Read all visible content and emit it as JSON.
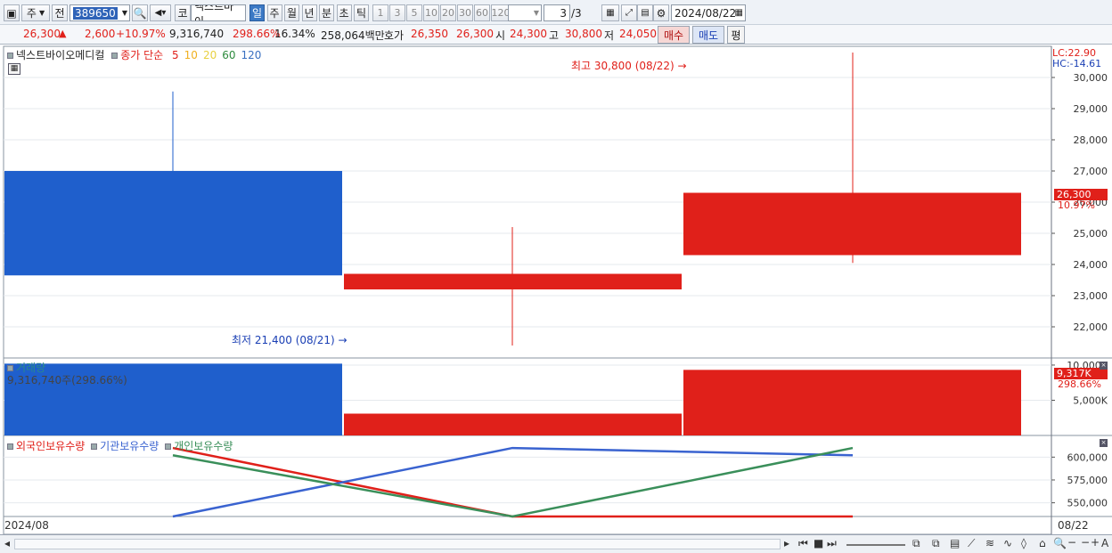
{
  "toolbar": {
    "market": "주",
    "prev": "전",
    "code": "389650",
    "kospi_tag": "코",
    "stock_name": "넥스트바이",
    "periods": [
      "일",
      "주",
      "월",
      "년",
      "분",
      "초",
      "틱"
    ],
    "active_period": "일",
    "intervals": [
      "1",
      "3",
      "5",
      "10",
      "20",
      "30",
      "60",
      "120"
    ],
    "page": "3",
    "page_total": "/3",
    "date": "2024/08/22"
  },
  "quote": {
    "price": "26,300",
    "arrow": "▲",
    "change": "2,600",
    "change_pct": "+10.97%",
    "volume": "9,316,740",
    "volume_ratio": "298.66%",
    "turnover": "16.34%",
    "amount": "258,064백만",
    "ask_label": "호가",
    "ask": "26,350",
    "bid": "26,300",
    "open_label": "시",
    "open": "24,300",
    "high_label": "고",
    "high": "30,800",
    "low_label": "저",
    "low": "24,050",
    "buy_label": "매수",
    "sell_label": "매도",
    "avg_label": "평"
  },
  "price_panel": {
    "title": "넥스트바이오메디컬",
    "indicator": "종가 단순",
    "ma_periods": [
      "5",
      "10",
      "20",
      "60",
      "120"
    ],
    "ma_colors": [
      "#e0201a",
      "#f0b020",
      "#e8d040",
      "#2e8b3e",
      "#3a70c0"
    ],
    "lc": "LC:22.90",
    "hc": "HC:-14.61",
    "high_note": "최고 30,800 (08/22)",
    "low_note": "최저 21,400 (08/21)",
    "last_price": "26,300",
    "last_pct": "10.97%"
  },
  "volume_panel": {
    "title": "거래량",
    "info": "9,316,740주(298.66%)",
    "last": "9,317K",
    "last_pct": "298.66%"
  },
  "holder_panel": {
    "legend": [
      "외국인보유수량",
      "기관보유수량",
      "개인보유수량"
    ],
    "colors": [
      "#e0201a",
      "#3a63d0",
      "#3a8f5a"
    ]
  },
  "x_axis": {
    "left_label": "2024/08",
    "right_label": "08/22"
  },
  "chart_data": {
    "type": "candlestick",
    "price": {
      "ylim": [
        21000,
        31000
      ],
      "yticks": [
        22000,
        23000,
        24000,
        25000,
        26000,
        27000,
        28000,
        29000,
        30000
      ],
      "ytick_labels": [
        "22,000",
        "23,000",
        "24,000",
        "25,000",
        "26,000",
        "27,000",
        "28,000",
        "29,000",
        "30,000"
      ],
      "candles": [
        {
          "open": 27000,
          "high": 29550,
          "low": 27000,
          "close": 23650,
          "color": "#1f5fcc"
        },
        {
          "open": 23200,
          "high": 25200,
          "low": 21400,
          "close": 23700,
          "color": "#e0201a"
        },
        {
          "open": 24300,
          "high": 30800,
          "low": 24050,
          "close": 26300,
          "color": "#e0201a"
        }
      ]
    },
    "volume": {
      "ylim": [
        0,
        10500000
      ],
      "yticks": [
        5000000,
        10000000
      ],
      "ytick_labels": [
        "5,000K",
        "10,000K"
      ],
      "bars": [
        {
          "value": 10200000,
          "color": "#1f5fcc"
        },
        {
          "value": 3100000,
          "color": "#e0201a"
        },
        {
          "value": 9316740,
          "color": "#e0201a"
        }
      ]
    },
    "holders": {
      "ylim": [
        535000,
        613000
      ],
      "yticks": [
        550000,
        575000,
        600000
      ],
      "ytick_labels": [
        "550,000",
        "575,000",
        "600,000"
      ],
      "series": [
        {
          "name": "외국인보유수량",
          "values": [
            610000,
            535000,
            535000
          ],
          "color": "#e0201a"
        },
        {
          "name": "기관보유수량",
          "values": [
            535000,
            610000,
            602000
          ],
          "color": "#3a63d0"
        },
        {
          "name": "개인보유수량",
          "values": [
            602000,
            535000,
            610000
          ],
          "color": "#3a8f5a"
        }
      ]
    }
  }
}
